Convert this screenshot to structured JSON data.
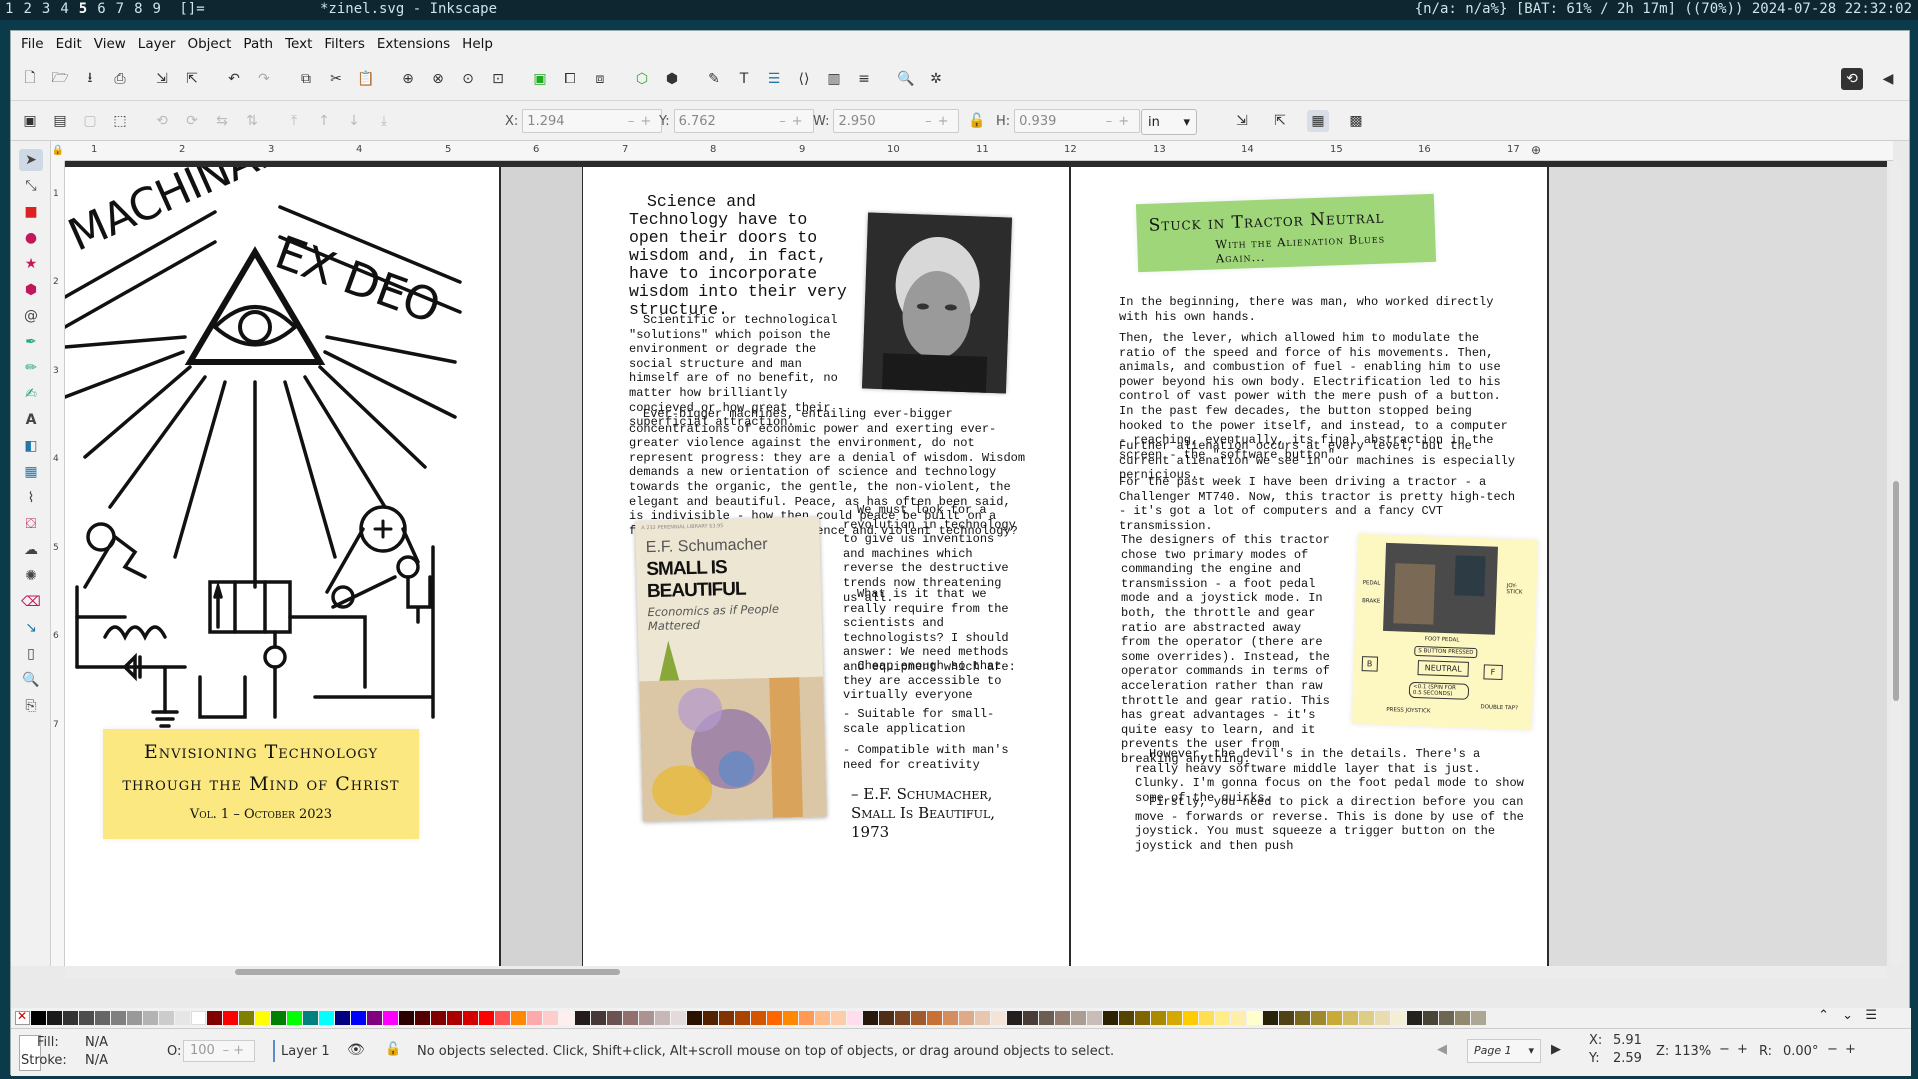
{
  "desktop": {
    "workspaces": [
      "1",
      "2",
      "3",
      "4",
      "5",
      "6",
      "7",
      "8",
      "9"
    ],
    "active_workspace": "5",
    "layout_indicator": "[]=",
    "window_title": "*zinel.svg - Inkscape",
    "status_text": "{n/a: n/a%} [BAT: 61% / 2h 17m] ((70%)) 2024-07-28 22:32:02"
  },
  "menu": [
    "File",
    "Edit",
    "View",
    "Layer",
    "Object",
    "Path",
    "Text",
    "Filters",
    "Extensions",
    "Help"
  ],
  "toolctl": {
    "x_label": "X:",
    "x_value": "1.294",
    "y_label": "Y:",
    "y_value": "6.762",
    "w_label": "W:",
    "w_value": "2.950",
    "h_label": "H:",
    "h_value": "0.939",
    "unit": "in"
  },
  "ruler": [
    "1",
    "2",
    "3",
    "4",
    "5",
    "6",
    "7",
    "8",
    "9",
    "10",
    "11",
    "12",
    "13",
    "14",
    "15",
    "16",
    "17"
  ],
  "ruler_v": [
    "1",
    "2",
    "3",
    "4",
    "5",
    "6",
    "7"
  ],
  "page1": {
    "title_left": "MACHINAE",
    "title_right": "EX DEO",
    "banner_line1": "Envisioning Technology",
    "banner_line2": "through the Mind of Christ",
    "banner_line3": "Vol. 1 – October 2023"
  },
  "page2": {
    "heading": "Science and Technology have to open their doors to wisdom and, in fact, have to incorporate wisdom into their very structure.",
    "para1": "Scientific or technological \"solutions\" which poison the environment or degrade the social structure and man himself are of no benefit, no matter how brilliantly concieved or how great their superficial attraction.",
    "para2": "Ever-bigger machines, entailing ever-bigger concentrations of economic power and exerting ever-greater violence against the environment, do not represent progress: they are a denial of wisdom. Wisdom demands a new orientation of science and technology towards the organic, the gentle, the non-violent, the elegant and beautiful. Peace, as has often been said, is indivisible - how then could peace be built on a foundation of reckless science and violent technology?",
    "para3": "We must look for a revolution in technology to give us inventions and machines which reverse the destructive trends now threatening us all.",
    "para4": "What is it that we really require from the scientists and technologists? I should answer: We need methods and equipment which are:",
    "bullet1": "- Cheap enough so that they are accessible to virtually everyone",
    "bullet2": "- Suitable for small-scale application",
    "bullet3": "- Compatible with man's need for creativity",
    "attribution1": "– E.F. Schumacher,",
    "attribution2": "Small Is Beautiful,",
    "attribution3": "1973",
    "book_series": "A 232 PERENNIAL LIBRARY $3.95",
    "book_author": "E.F. Schumacher",
    "book_title": "SMALL IS BEAUTIFUL",
    "book_subtitle": "Economics as if People Mattered"
  },
  "page3": {
    "title_line1": "Stuck in Tractor Neutral",
    "title_line2": "With the Alienation Blues Again...",
    "para1": "In the beginning, there was man, who worked directly with his own hands.",
    "para2": "Then, the lever, which allowed him to modulate the ratio of the speed and force of his movements. Then, animals, and combustion of fuel - enabling him to use power beyond his own body. Electrification led to his control of vast power with the mere push of a button. In the past few decades, the button stopped being hooked to the power itself, and instead, to a computer - reaching, eventually, its final abstraction in the screen - the \"software button\".",
    "para3": "Further alienation occurs at every level, but the current alienation we see in our machines is especially pernicious.",
    "para4": "For the past week I have been driving a tractor - a Challenger MT740. Now, this tractor is pretty high-tech - it's got a lot of computers and a fancy CVT transmission.",
    "para5": "The designers of this tractor chose two primary modes of commanding the engine and transmission - a foot pedal mode and a joystick mode. In both, the throttle and gear ratio are abstracted away from the operator (there are some overrides). Instead, the operator commands in terms of acceleration rather than raw throttle and gear ratio. This has great advantages - it's quite easy to learn, and it prevents the user from breaking anything.",
    "para6": "However, the devil's in the details. There's a really heavy software middle layer that is just. Clunky. I'm gonna focus on the foot pedal mode to show some of the quirks.",
    "para7": "Firstly, you need to pick a direction before you can move - forwards or reverse. This is done by use of the joystick. You must squeeze a trigger button on the joystick and then push",
    "diagram": {
      "lbl_pedal": "PEDAL",
      "lbl_brake": "BRAKE",
      "lbl_joystick": "JOY-STICK",
      "lbl_foot": "FOOT PEDAL",
      "lbl_sbutton": "S BUTTON PRESSED",
      "lbl_b": "B",
      "lbl_neutral": "NEUTRAL",
      "lbl_f": "F",
      "lbl_01": "<0.1 (SPIN FOR 0.5 SECONDS)",
      "lbl_press": "PRESS JOYSTICK",
      "lbl_double": "DOUBLE TAP?"
    }
  },
  "status": {
    "fill_label": "Fill:",
    "fill_value": "N/A",
    "stroke_label": "Stroke:",
    "stroke_value": "N/A",
    "opacity_label": "O:",
    "opacity_value": "100",
    "layer": "Layer 1",
    "message": "No objects selected. Click, Shift+click, Alt+scroll mouse on top of objects, or drag around objects to select.",
    "page": "Page 1",
    "cursor_x_label": "X:",
    "cursor_x": "5.91",
    "cursor_y_label": "Y:",
    "cursor_y": "2.59",
    "zoom_label": "Z:",
    "zoom": "113%",
    "rotate_label": "R:",
    "rotate": "0.00°"
  },
  "colors": {
    "banner_yellow": "#fce880",
    "title_green": "#9fd67a",
    "note_yellow": "#fdf7c2",
    "canvas_bg": "#2b2b2b"
  }
}
